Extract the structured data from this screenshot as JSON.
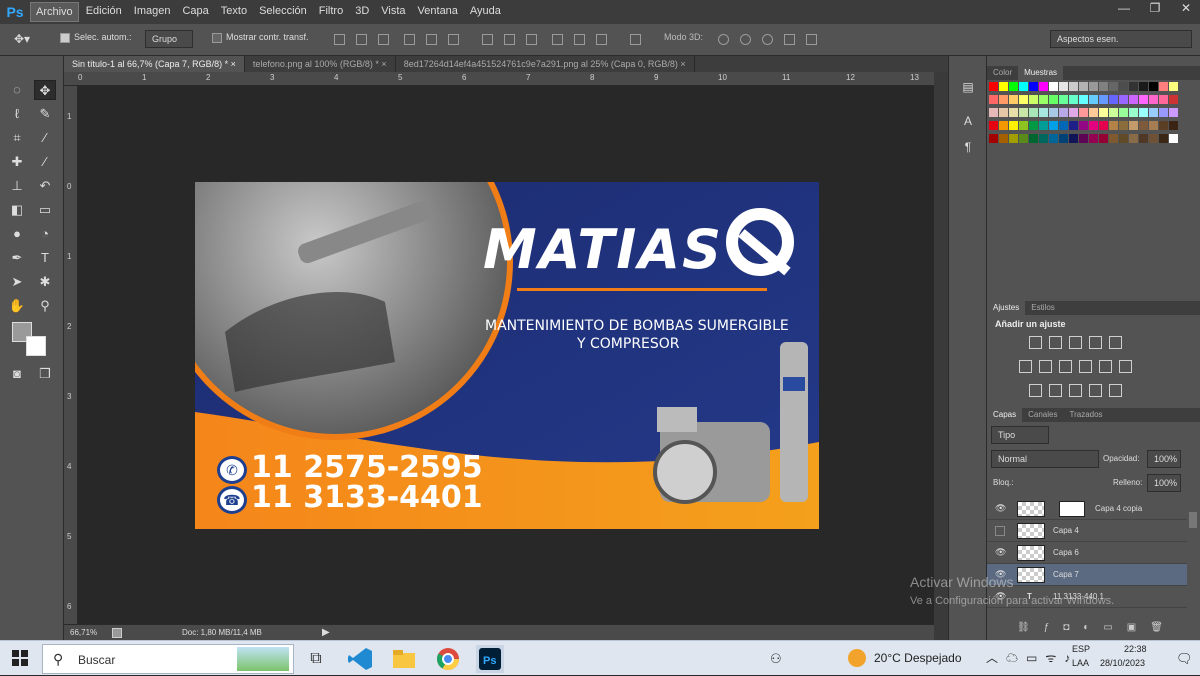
{
  "app": {
    "logo": "Ps",
    "accent": "#31a8ff"
  },
  "menu": [
    "Archivo",
    "Edición",
    "Imagen",
    "Capa",
    "Texto",
    "Selección",
    "Filtro",
    "3D",
    "Vista",
    "Ventana",
    "Ayuda"
  ],
  "window_controls": [
    "—",
    "❐",
    "✕"
  ],
  "options": {
    "auto_select_label": "Selec. autom.:",
    "auto_select_value": "Grupo",
    "show_transform_label": "Mostrar contr. transf.",
    "mode3d_label": "Modo 3D:",
    "workspace": "Aspectos esen."
  },
  "tabs": [
    "Sin título-1 al 66,7% (Capa 7, RGB/8) *  ×",
    "telefono.png al 100% (RGB/8) *  ×",
    "8ed17264d14ef4a451524761c9e7a291.png al 25% (Capa 0, RGB/8)  ×"
  ],
  "ruler_top": [
    "0",
    "1",
    "2",
    "3",
    "4",
    "5",
    "6",
    "7",
    "8",
    "9",
    "10",
    "11",
    "12",
    "13"
  ],
  "ruler_left": [
    "1",
    "0",
    "1",
    "2",
    "3",
    "4",
    "5",
    "6"
  ],
  "canvas": {
    "brand": "MATIAS",
    "service_line1": "MANTENIMIENTO DE BOMBAS SUMERGIBLE",
    "service_line2": "Y COMPRESOR",
    "phone1": "11 2575-2595",
    "phone2": "11 3133-4401",
    "colors": {
      "navy": "#1e2a6a",
      "orange": "#f07d16",
      "white": "#ffffff"
    }
  },
  "status": {
    "zoom": "66,71%",
    "doc": "Doc: 1,80 MB/11,4 MB"
  },
  "panels": {
    "color_tabs": [
      "Color",
      "Muestras"
    ],
    "adjust_tabs": [
      "Ajustes",
      "Estilos"
    ],
    "adjust_title": "Añadir un ajuste",
    "layers_tabs": [
      "Capas",
      "Canales",
      "Trazados"
    ],
    "filter_kind": "Tipo",
    "blend_mode": "Normal",
    "opacity_label": "Opacidad:",
    "opacity_value": "100%",
    "lock_label": "Bloq.:",
    "fill_label": "Relleno:",
    "fill_value": "100%",
    "layers": [
      {
        "name": "Capa 4 copia",
        "visible": true
      },
      {
        "name": "Capa 4",
        "visible": false
      },
      {
        "name": "Capa 6",
        "visible": true
      },
      {
        "name": "Capa 7",
        "visible": true
      },
      {
        "name": "11 3133-440 1",
        "visible": true
      }
    ]
  },
  "watermark": {
    "line1": "Activar Windows",
    "line2": "Ve a Configuración para activar Windows."
  },
  "taskbar": {
    "search": "Buscar",
    "weather": "20°C  Despejado",
    "lang1": "ESP",
    "lang2": "LAA",
    "time": "22:38",
    "date": "28/10/2023"
  }
}
